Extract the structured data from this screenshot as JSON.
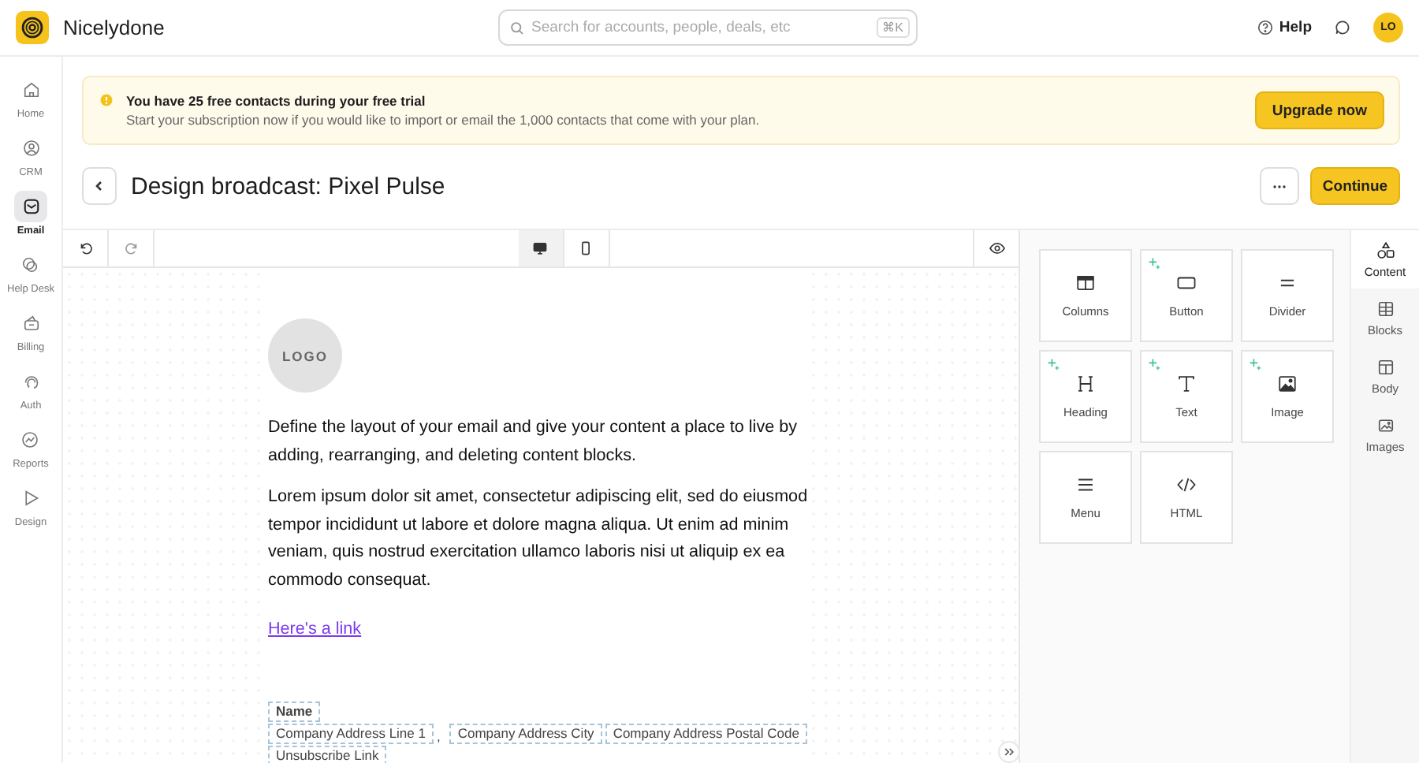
{
  "app": {
    "name": "Nicelydone"
  },
  "search": {
    "placeholder": "Search for accounts, people, deals, etc",
    "shortcut": "⌘K"
  },
  "header": {
    "help": "Help",
    "avatar": "LO"
  },
  "nav": [
    {
      "label": "Home",
      "kind": "home",
      "selected": false
    },
    {
      "label": "CRM",
      "kind": "person",
      "selected": false
    },
    {
      "label": "Email",
      "kind": "mail",
      "selected": true
    },
    {
      "label": "Help Desk",
      "kind": "chat",
      "selected": false
    },
    {
      "label": "Billing",
      "kind": "billing",
      "selected": false
    },
    {
      "label": "Auth",
      "kind": "auth",
      "selected": false
    },
    {
      "label": "Reports",
      "kind": "chart",
      "selected": false
    },
    {
      "label": "Design",
      "kind": "pointer",
      "selected": false
    }
  ],
  "banner": {
    "title": "You have 25 free contacts during your free trial",
    "text": "Start your subscription now if you would like to import or email the 1,000 contacts that come with your plan.",
    "button": "Upgrade now"
  },
  "page": {
    "title": "Design broadcast: Pixel Pulse",
    "button": "Continue"
  },
  "devices": [
    {
      "kind": "desktop",
      "selected": true
    },
    {
      "kind": "mobile",
      "selected": false
    }
  ],
  "email": {
    "logo": "LOGO",
    "paragraphs": [
      "Define the layout of your email and give your content a place to live by adding, rearranging, and deleting content blocks.",
      "Lorem ipsum dolor sit amet, consectetur adipiscing elit, sed do eiusmod tempor incididunt ut labore et dolore magna aliqua. Ut enim ad minim veniam, quis nostrud exercitation ullamco laboris nisi ut aliquip ex ea commodo consequat."
    ],
    "link": "Here's a link",
    "footer": {
      "name": "Name",
      "address": [
        {
          "text": "Company Address Line 1",
          "suffix": ","
        },
        {
          "text": "Company Address City"
        },
        {
          "text": "Company Address Postal Code"
        }
      ],
      "unsubscribe": "Unsubscribe Link"
    }
  },
  "tiles": [
    {
      "label": "Columns",
      "kind": "columns",
      "ai": false
    },
    {
      "label": "Button",
      "kind": "button",
      "ai": true
    },
    {
      "label": "Divider",
      "kind": "divider",
      "ai": false
    },
    {
      "label": "Heading",
      "kind": "heading",
      "ai": true
    },
    {
      "label": "Text",
      "kind": "text",
      "ai": true
    },
    {
      "label": "Image",
      "kind": "image",
      "ai": true
    },
    {
      "label": "Menu",
      "kind": "menu",
      "ai": false
    },
    {
      "label": "HTML",
      "kind": "code",
      "ai": false
    }
  ],
  "panel_tabs": [
    {
      "label": "Content",
      "kind": "shapes",
      "selected": true
    },
    {
      "label": "Blocks",
      "kind": "grid",
      "selected": false
    },
    {
      "label": "Body",
      "kind": "layout",
      "selected": false
    },
    {
      "label": "Images",
      "kind": "images",
      "selected": false
    }
  ]
}
